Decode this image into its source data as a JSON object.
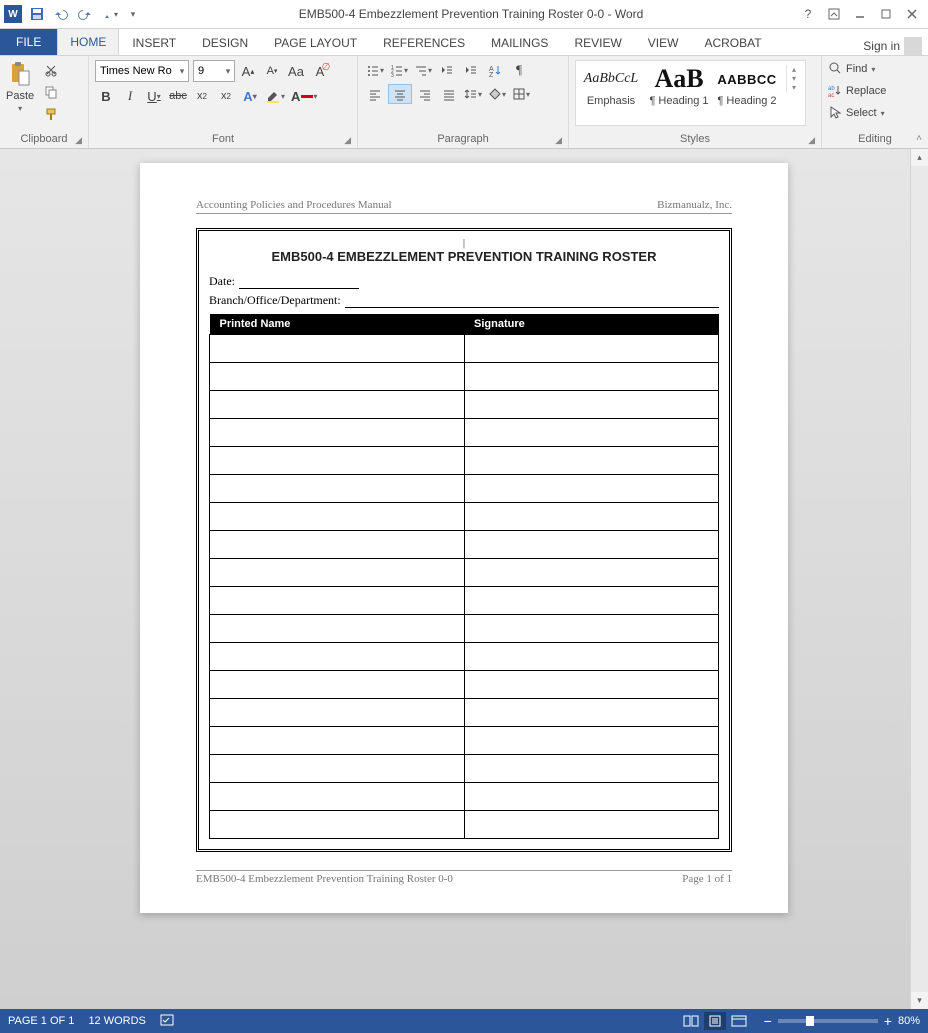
{
  "titlebar": {
    "title": "EMB500-4 Embezzlement Prevention Training Roster 0-0 - Word"
  },
  "qat": {
    "save": "save-icon",
    "undo": "undo-icon",
    "redo": "redo-icon",
    "touch": "touch-mode-icon",
    "customize": "customize-qat-icon"
  },
  "window": {
    "help": "?",
    "ribbon_opts": "ribbon-display-options-icon",
    "min": "minimize-icon",
    "max": "maximize-icon",
    "close": "close-icon"
  },
  "tabs": {
    "file": "FILE",
    "items": [
      "HOME",
      "INSERT",
      "DESIGN",
      "PAGE LAYOUT",
      "REFERENCES",
      "MAILINGS",
      "REVIEW",
      "VIEW",
      "ACROBAT"
    ],
    "active_index": 0,
    "signin": "Sign in"
  },
  "ribbon": {
    "clipboard": {
      "label": "Clipboard",
      "paste": "Paste",
      "cut": "cut-icon",
      "copy": "copy-icon",
      "format_painter": "format-painter-icon"
    },
    "font": {
      "label": "Font",
      "name": "Times New Ro",
      "size": "9",
      "grow": "A",
      "shrink": "A",
      "case": "Aa",
      "clear": "clear-formatting-icon",
      "bold": "B",
      "italic": "I",
      "underline": "U",
      "strike": "abc",
      "sub": "x",
      "sup": "x",
      "effects": "A",
      "highlight": "highlight-icon",
      "color": "A"
    },
    "paragraph": {
      "label": "Paragraph",
      "bullets": "bullets-icon",
      "numbering": "numbering-icon",
      "multilevel": "multilevel-icon",
      "dec_indent": "decrease-indent-icon",
      "inc_indent": "increase-indent-icon",
      "sort": "sort-icon",
      "marks": "¶",
      "align_l": "align-left-icon",
      "align_c": "align-center-icon",
      "align_r": "align-right-icon",
      "align_j": "justify-icon",
      "spacing": "line-spacing-icon",
      "shading": "shading-icon",
      "borders": "borders-icon"
    },
    "styles": {
      "label": "Styles",
      "items": [
        {
          "sample": "AaBbCcL",
          "name": "Emphasis",
          "cls": "emph"
        },
        {
          "sample": "AaB",
          "name": "¶ Heading 1",
          "cls": "h1"
        },
        {
          "sample": "AABBCC",
          "name": "¶ Heading 2",
          "cls": "h2"
        }
      ]
    },
    "editing": {
      "label": "Editing",
      "find": "Find",
      "replace": "Replace",
      "select": "Select"
    }
  },
  "document": {
    "header_left": "Accounting Policies and Procedures Manual",
    "header_right": "Bizmanualz, Inc.",
    "title": "EMB500-4 EMBEZZLEMENT PREVENTION TRAINING ROSTER",
    "date_label": "Date:",
    "branch_label": "Branch/Office/Department:",
    "col1": "Printed Name",
    "col2": "Signature",
    "rows": 18,
    "footer_left": "EMB500-4 Embezzlement Prevention Training Roster 0-0",
    "footer_right": "Page 1 of 1"
  },
  "statusbar": {
    "page": "PAGE 1 OF 1",
    "words": "12 WORDS",
    "zoom_pct": "80%",
    "zoom_minus": "−",
    "zoom_plus": "+"
  }
}
